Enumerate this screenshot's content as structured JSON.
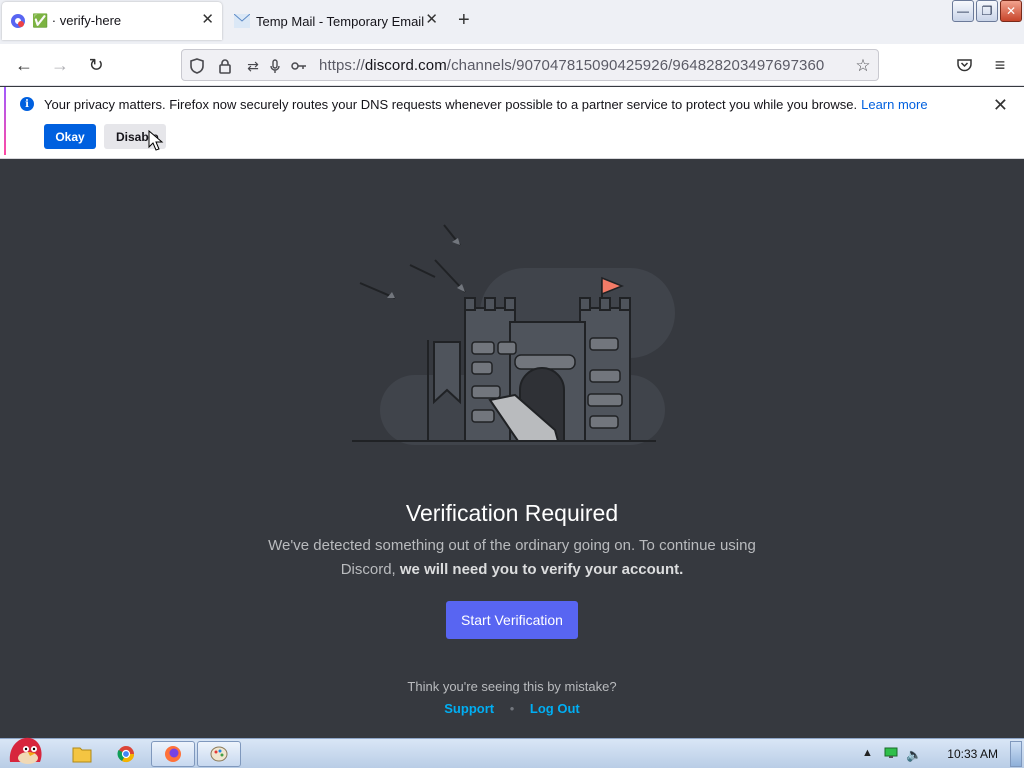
{
  "browser": {
    "tabs": [
      {
        "label": "✅ · verify-here",
        "active": true
      },
      {
        "label": "Temp Mail - Temporary Email",
        "active": false
      }
    ],
    "url": {
      "prefix": "https://",
      "host": "discord.com",
      "path": "/channels/907047815090425926/964828203497697360"
    },
    "icons": [
      "back-icon",
      "forward-icon",
      "reload-icon",
      "shield-icon",
      "lock-icon",
      "permissions-icon",
      "microphone-icon",
      "key-icon",
      "bookmark-star-icon",
      "pocket-icon",
      "menu-icon"
    ]
  },
  "notification": {
    "text": "Your privacy matters. Firefox now securely routes your DNS requests whenever possible to a partner service to protect you while you browse.",
    "link": "Learn more",
    "okay_label": "Okay",
    "disable_label": "Disable"
  },
  "page": {
    "title": "Verification Required",
    "desc_line1": "We've detected something out of the ordinary going on. To continue using",
    "desc_prefix": "Discord, ",
    "desc_bold": "we will need you to verify your account.",
    "button_label": "Start Verification",
    "mistake_text": "Think you're seeing this by mistake?",
    "support_label": "Support",
    "separator": "•",
    "logout_label": "Log Out"
  },
  "taskbar": {
    "clock": "10:33 AM",
    "colors": {
      "accent": "#5865f2",
      "background": "#36393f",
      "link": "#00aff4"
    }
  }
}
